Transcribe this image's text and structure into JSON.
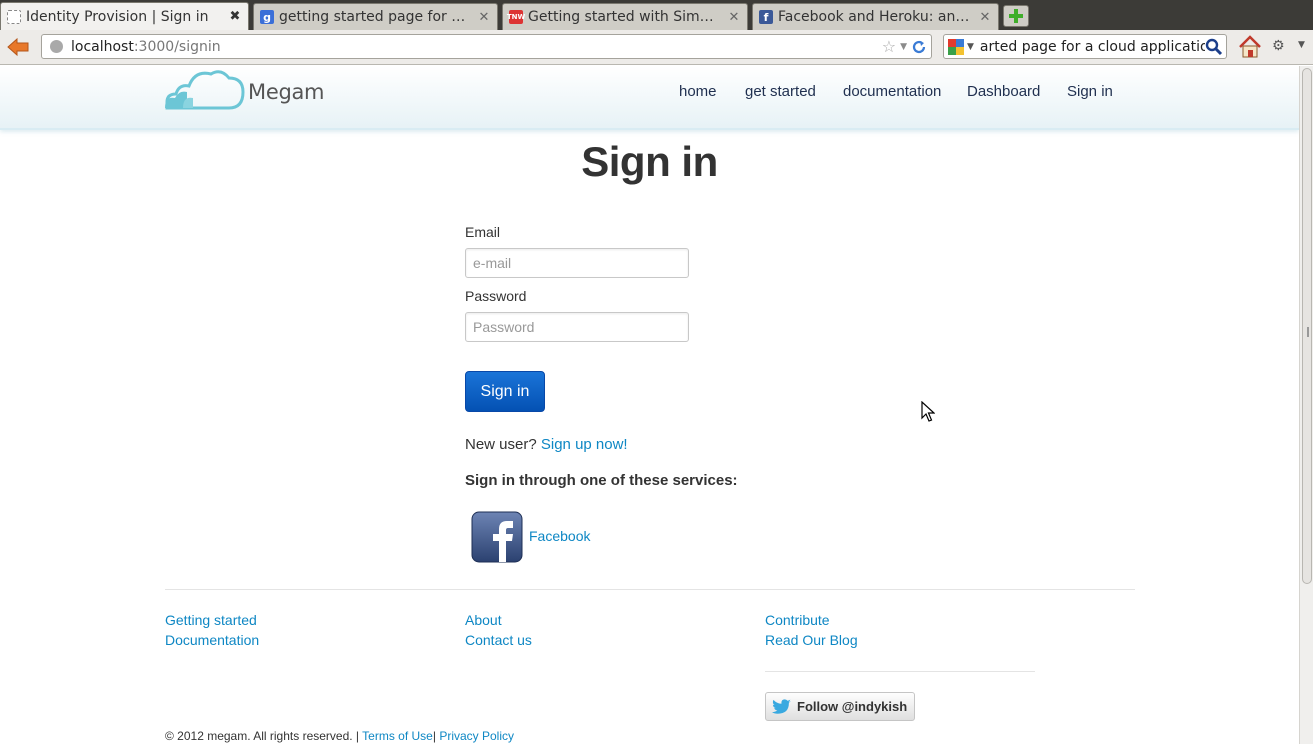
{
  "browser": {
    "tabs": [
      {
        "title": "Identity Provision | Sign in",
        "active": true
      },
      {
        "title": "getting started page for a c…",
        "active": false
      },
      {
        "title": "Getting started with Simple…",
        "active": false
      },
      {
        "title": "Facebook and Heroku: an e…",
        "active": false
      }
    ],
    "url_host": "localhost",
    "url_path": ":3000/signin",
    "search_query": "arted page for a cloud application"
  },
  "header": {
    "brand": "Megam",
    "nav": [
      "home",
      "get started",
      "documentation",
      "Dashboard",
      "Sign in"
    ]
  },
  "main": {
    "title": "Sign in",
    "email_label": "Email",
    "email_placeholder": "e-mail",
    "password_label": "Password",
    "password_placeholder": "Password",
    "submit_label": "Sign in",
    "new_user_text": "New user?",
    "signup_link": "Sign up now!",
    "services_heading": "Sign in through one of these services:",
    "facebook_label": "Facebook"
  },
  "footer": {
    "col1": [
      "Getting started",
      "Documentation"
    ],
    "col2": [
      "About",
      "Contact us"
    ],
    "col3": [
      "Contribute",
      "Read Our Blog"
    ],
    "follow_label": "Follow @indykish",
    "copyright": "© 2012 megam. All rights reserved. |",
    "terms": "Terms of Use",
    "sep": "|",
    "privacy": "Privacy Policy"
  },
  "colors": {
    "link": "#0e87c4",
    "primary_button": "#0451b3",
    "header_gradient_end": "#e7f2f6",
    "logo_cloud": "#6cc6d6"
  }
}
